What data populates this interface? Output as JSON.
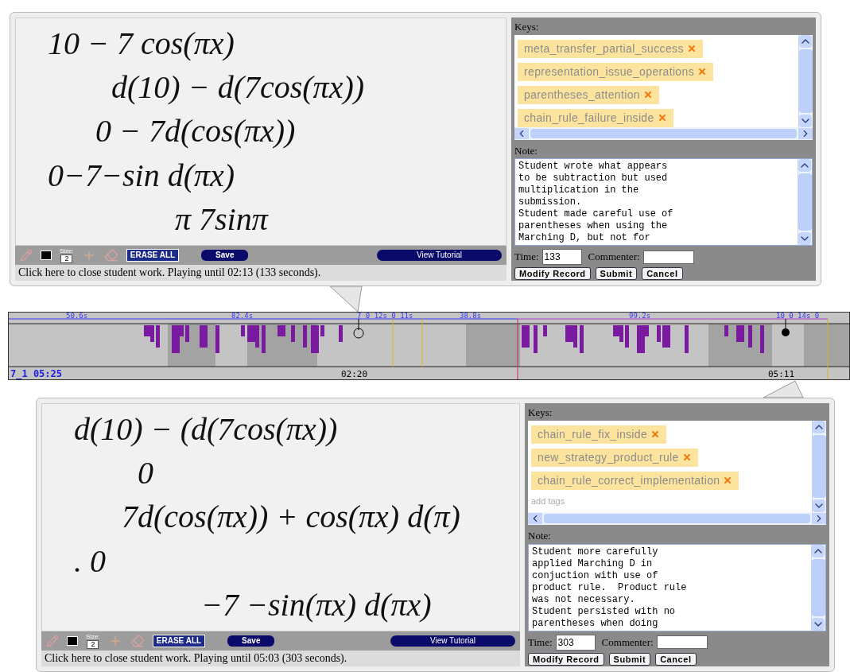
{
  "panels": [
    {
      "canvas_lines": [
        "10 − 7 cos(πx)",
        "d(10) − d(7cos(πx))",
        "0 − 7d(cos(πx))",
        "0−7−sin d(πx)",
        "π      7sinπ"
      ],
      "toolbar": {
        "size_label": "Size:",
        "size_value": "2",
        "erase_all": "ERASE ALL",
        "save": "Save",
        "tutorial": "View Tutorial"
      },
      "status": "Click here to close student work. Playing until 02:13 (133 seconds).",
      "keys_label": "Keys:",
      "tags": [
        {
          "label": "meta_transfer_partial_success"
        },
        {
          "label": "representation_issue_operations"
        },
        {
          "label": "parentheses_attention"
        },
        {
          "label": "chain_rule_failure_inside"
        }
      ],
      "note_label": "Note:",
      "note": "Student wrote what appears\nto be subtraction but used\nmultiplication in the\nsubmission.\nStudent made careful use of\nparentheses when using the\nMarching D, but not for",
      "time_label": "Time:",
      "time": "133",
      "commenter_label": "Commenter:",
      "buttons": [
        "Modify Record",
        "Submit",
        "Cancel"
      ]
    },
    {
      "canvas_lines": [
        "d(10) − (d(7cos(πx))",
        "0",
        "7d(cos(πx)) + cos(πx) d(π)",
        ". 0",
        "−7 −sin(πx) d(πx)"
      ],
      "toolbar": {
        "size_label": "Size:",
        "size_value": "2",
        "erase_all": "ERASE ALL",
        "save": "Save",
        "tutorial": "View Tutorial"
      },
      "status": "Click here to close student work. Playing until 05:03 (303 seconds).",
      "keys_label": "Keys:",
      "tags": [
        {
          "label": "chain_rule_fix_inside"
        },
        {
          "label": "new_strategy_product_rule"
        },
        {
          "label": "chain_rule_correct_implementation"
        }
      ],
      "tags_placeholder": "add tags",
      "note_label": "Note:",
      "note": "Student more carefully\napplied Marching D in\nconjuction with use of\nproduct rule.  Product rule\nwas not necessary.\nStudent persisted with no\nparentheses when doing",
      "time_label": "Time:",
      "time": "303",
      "commenter_label": "Commenter:",
      "buttons": [
        "Modify Record",
        "Submit",
        "Cancel"
      ]
    }
  ],
  "timeline": {
    "top_labels": [
      "50.6s",
      "82.4s",
      "7 0 12s 0 11s",
      "38.8s",
      "99.2s",
      "10 0 14s 0"
    ],
    "session": "7_1 05:25",
    "marks": [
      "02:20",
      "05:11"
    ]
  }
}
